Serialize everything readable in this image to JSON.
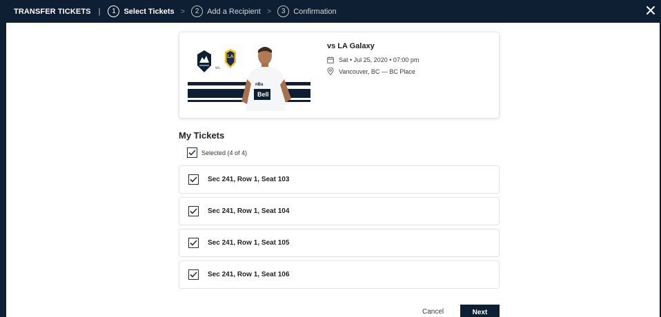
{
  "header": {
    "title": "TRANSFER TICKETS",
    "separator": "|",
    "steps": [
      {
        "number": "1",
        "label": "Select Tickets",
        "state": "active"
      },
      {
        "number": "2",
        "label": "Add a Recipient",
        "state": "inactive"
      },
      {
        "number": "3",
        "label": "Confirmation",
        "state": "inactive"
      }
    ],
    "close_icon": "close-icon"
  },
  "event": {
    "versus_text": "vs.",
    "home_badge_text": "LA",
    "sponsor_text": "Bell",
    "jersey_text": "nBa",
    "title": "vs LA Galaxy",
    "date": "Sat • Jul 25, 2020 • 07:00 pm",
    "venue": "Vancouver, BC — BC Place"
  },
  "tickets": {
    "heading": "My Tickets",
    "select_all_label": "Selected (4 of 4)",
    "items": [
      {
        "label": "Sec 241, Row 1, Seat 103",
        "checked": true
      },
      {
        "label": "Sec 241, Row 1, Seat 104",
        "checked": true
      },
      {
        "label": "Sec 241, Row 1, Seat 105",
        "checked": true
      },
      {
        "label": "Sec 241, Row 1, Seat 106",
        "checked": true
      }
    ]
  },
  "actions": {
    "cancel_label": "Cancel",
    "next_label": "Next"
  },
  "colors": {
    "navy": "#0e1f33",
    "border": "#e2e2e2",
    "galaxy_gold": "#f2c21b",
    "galaxy_navy": "#1a2a55"
  }
}
